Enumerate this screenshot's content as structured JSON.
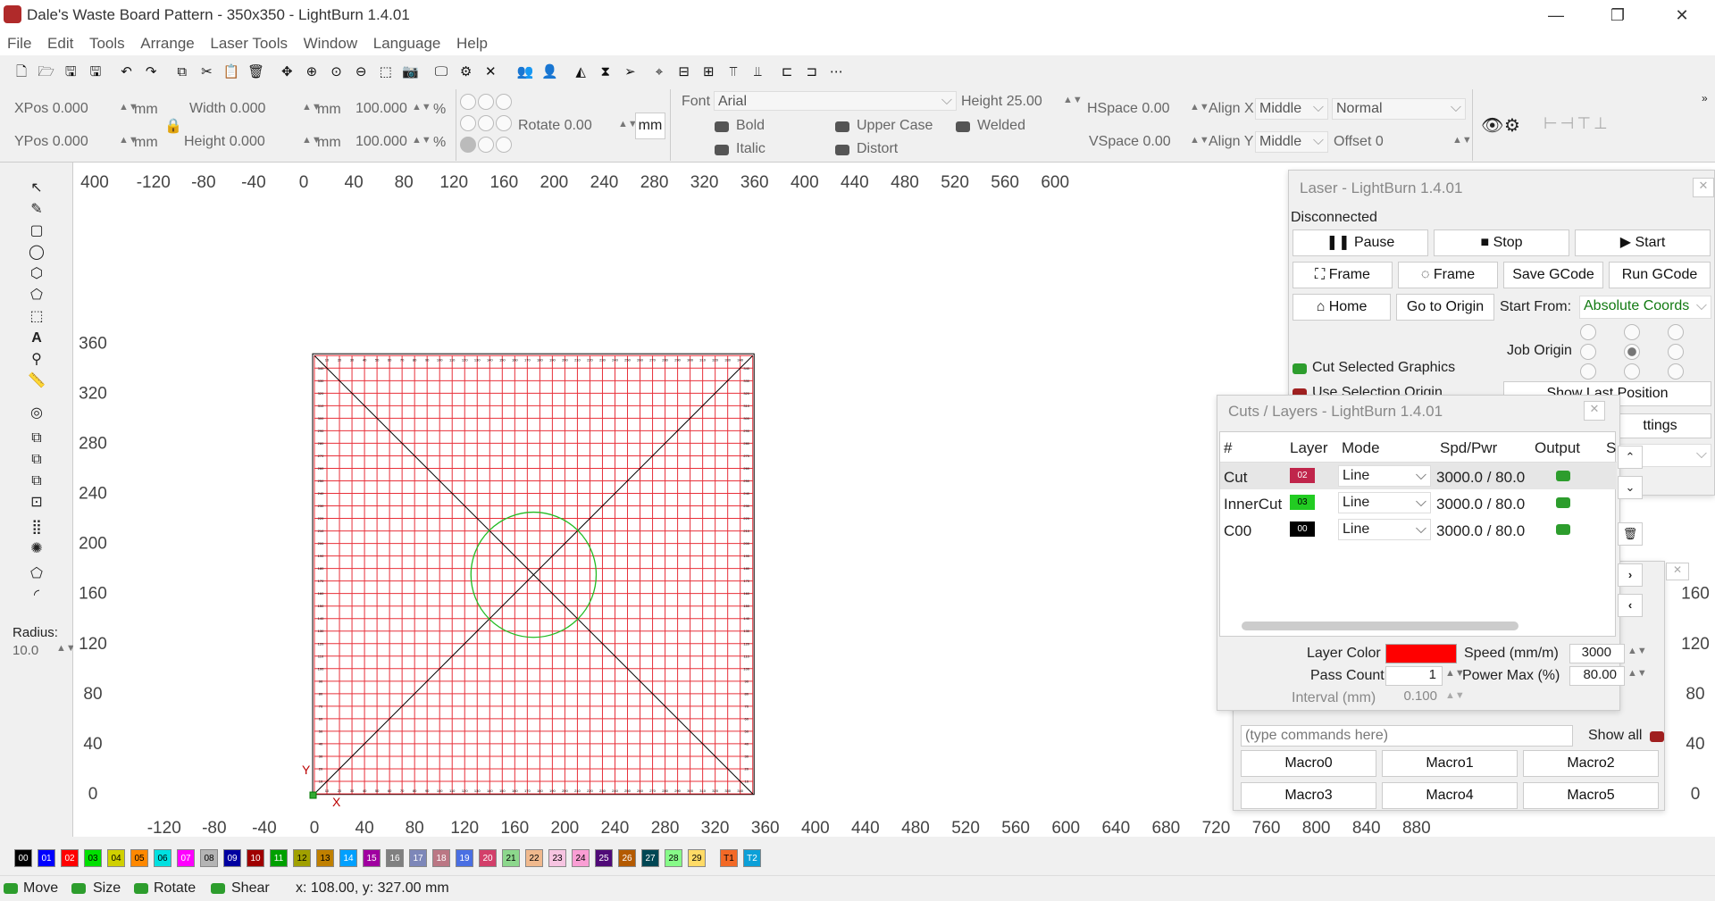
{
  "window": {
    "title": "Dale's Waste Board Pattern - 350x350 - LightBurn 1.4.01",
    "minimize": "—",
    "maximize": "❐",
    "close": "✕"
  },
  "menu": [
    "File",
    "Edit",
    "Tools",
    "Arrange",
    "Laser Tools",
    "Window",
    "Language",
    "Help"
  ],
  "props": {
    "xpos": "XPos 0.000",
    "ypos": "YPos 0.000",
    "unit": "mm",
    "width": "Width 0.000",
    "height": "Height 0.000",
    "scale_w": "100.000",
    "scale_h": "100.000",
    "pct": "%",
    "rotate": "Rotate 0.00",
    "rotate_unit": "mm",
    "font_label": "Font",
    "font_value": "Arial",
    "text_height": "Height 25.00",
    "bold": "Bold",
    "italic": "Italic",
    "upper": "Upper Case",
    "distort": "Distort",
    "welded": "Welded",
    "hspace": "HSpace 0.00",
    "vspace": "VSpace 0.00",
    "alignx_label": "Align X",
    "alignx": "Middle",
    "aligny_label": "Align Y",
    "aligny": "Middle",
    "normal": "Normal",
    "offset": "Offset 0"
  },
  "leftpanel": {
    "radius_label": "Radius:",
    "radius_value": "10.0"
  },
  "ruler": {
    "x_top": [
      "400",
      "-120",
      "-80",
      "-40",
      "0",
      "40",
      "80",
      "120",
      "160",
      "200",
      "240",
      "280",
      "320",
      "360",
      "400",
      "440",
      "480",
      "520",
      "560",
      "600"
    ],
    "x_bottom": [
      "-120",
      "-80",
      "-40",
      "0",
      "40",
      "80",
      "120",
      "160",
      "200",
      "240",
      "280",
      "320",
      "360",
      "400",
      "440",
      "480",
      "520",
      "560",
      "600",
      "640",
      "680",
      "720",
      "760",
      "800",
      "840",
      "880"
    ],
    "y_left": [
      "360",
      "320",
      "280",
      "240",
      "200",
      "160",
      "120",
      "80",
      "40",
      "0"
    ],
    "y_right": [
      "160",
      "120",
      "80",
      "40",
      "0"
    ]
  },
  "laser_panel": {
    "title": "Laser - LightBurn 1.4.01",
    "status": "Disconnected",
    "pause": "Pause",
    "stop": "Stop",
    "start": "Start",
    "frame1": "Frame",
    "frame2": "Frame",
    "save_gcode": "Save GCode",
    "run_gcode": "Run GCode",
    "home": "Home",
    "go_origin": "Go to Origin",
    "start_from_label": "Start From:",
    "start_from": "Absolute Coords",
    "job_origin": "Job Origin",
    "cut_selected": "Cut Selected Graphics",
    "use_selection": "Use Selection Origin",
    "show_last": "Show Last Position",
    "settings": "ttings"
  },
  "cuts_panel": {
    "title": "Cuts / Layers - LightBurn 1.4.01",
    "headers": [
      "#",
      "Layer",
      "Mode",
      "Spd/Pwr",
      "Output",
      "S"
    ],
    "rows": [
      {
        "name": "Cut",
        "layer": "02",
        "color": "#c0254b",
        "mode": "Line",
        "spdpwr": "3000.0 / 80.0"
      },
      {
        "name": "InnerCut",
        "layer": "03",
        "color": "#22cc22",
        "mode": "Line",
        "spdpwr": "3000.0 / 80.0"
      },
      {
        "name": "C00",
        "layer": "00",
        "color": "#000000",
        "mode": "Line",
        "spdpwr": "3000.0 / 80.0"
      }
    ],
    "layer_color_label": "Layer Color",
    "layer_color": "#ff0000",
    "speed_label": "Speed (mm/m)",
    "speed": "3000",
    "pass_label": "Pass Count",
    "pass": "1",
    "power_label": "Power Max (%)",
    "power": "80.00",
    "interval_label": "Interval (mm)",
    "interval": "0.100"
  },
  "console": {
    "placeholder": "(type commands here)",
    "show_all": "Show all",
    "macros": [
      "Macro0",
      "Macro1",
      "Macro2",
      "Macro3",
      "Macro4",
      "Macro5"
    ]
  },
  "palette": [
    {
      "id": "00",
      "color": "#000000",
      "text": "#fff"
    },
    {
      "id": "01",
      "color": "#0000ff",
      "text": "#fff"
    },
    {
      "id": "02",
      "color": "#ff0000",
      "text": "#fff"
    },
    {
      "id": "03",
      "color": "#00e000",
      "text": "#000"
    },
    {
      "id": "04",
      "color": "#d0d000",
      "text": "#000"
    },
    {
      "id": "05",
      "color": "#ff8800",
      "text": "#000"
    },
    {
      "id": "06",
      "color": "#00e0e0",
      "text": "#000"
    },
    {
      "id": "07",
      "color": "#ff00ff",
      "text": "#fff"
    },
    {
      "id": "08",
      "color": "#b4b4b4",
      "text": "#000"
    },
    {
      "id": "09",
      "color": "#0000a0",
      "text": "#fff"
    },
    {
      "id": "10",
      "color": "#a00000",
      "text": "#fff"
    },
    {
      "id": "11",
      "color": "#00a000",
      "text": "#fff"
    },
    {
      "id": "12",
      "color": "#a0a000",
      "text": "#000"
    },
    {
      "id": "13",
      "color": "#c08000",
      "text": "#000"
    },
    {
      "id": "14",
      "color": "#00a0ff",
      "text": "#fff"
    },
    {
      "id": "15",
      "color": "#a000a0",
      "text": "#fff"
    },
    {
      "id": "16",
      "color": "#808080",
      "text": "#fff"
    },
    {
      "id": "17",
      "color": "#7d87b9",
      "text": "#fff"
    },
    {
      "id": "18",
      "color": "#bb7784",
      "text": "#fff"
    },
    {
      "id": "19",
      "color": "#4a6fe3",
      "text": "#fff"
    },
    {
      "id": "20",
      "color": "#d33f6a",
      "text": "#fff"
    },
    {
      "id": "21",
      "color": "#8cd78c",
      "text": "#000"
    },
    {
      "id": "22",
      "color": "#f0b98d",
      "text": "#000"
    },
    {
      "id": "23",
      "color": "#f6c4e1",
      "text": "#000"
    },
    {
      "id": "24",
      "color": "#fa9ed4",
      "text": "#000"
    },
    {
      "id": "25",
      "color": "#500a78",
      "text": "#fff"
    },
    {
      "id": "26",
      "color": "#b45a00",
      "text": "#fff"
    },
    {
      "id": "27",
      "color": "#004754",
      "text": "#fff"
    },
    {
      "id": "28",
      "color": "#86fa88",
      "text": "#000"
    },
    {
      "id": "29",
      "color": "#ffdb66",
      "text": "#000"
    },
    {
      "id": "T1",
      "color": "#f36926",
      "text": "#000"
    },
    {
      "id": "T2",
      "color": "#0ca0d8",
      "text": "#fff"
    }
  ],
  "status": {
    "move": "Move",
    "size": "Size",
    "rotate": "Rotate",
    "shear": "Shear",
    "coords": "x: 108.00, y: 327.00 mm"
  },
  "board": {
    "width_mm": 350,
    "height_mm": 350,
    "circle_center_mm": [
      175,
      175
    ],
    "circle_radius_mm": 50,
    "grid_mm": 10
  }
}
